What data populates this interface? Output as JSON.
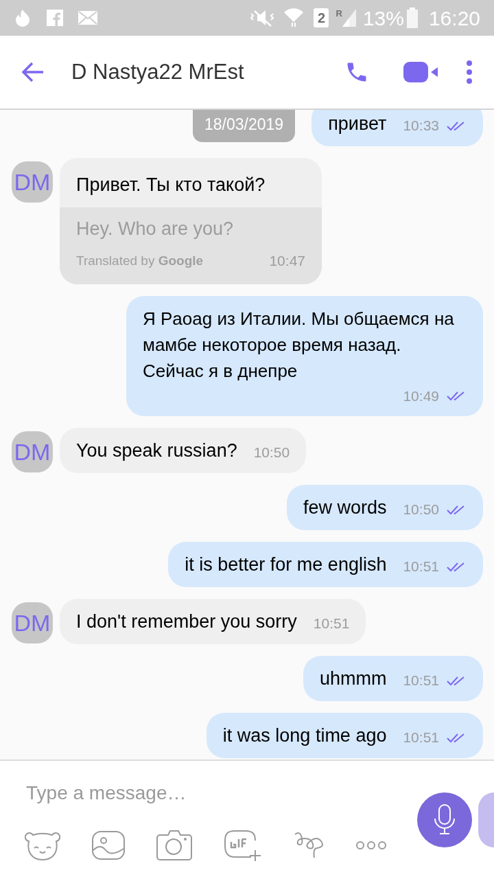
{
  "status_bar": {
    "sim_slot": "2",
    "roaming": "R",
    "battery": "13%",
    "time": "16:20"
  },
  "header": {
    "title": "D Nastya22 MrEst"
  },
  "date_chip": "18/03/2019",
  "messages": [
    {
      "kind": "outgoing",
      "text": "привет",
      "time": "10:33",
      "read": true
    },
    {
      "kind": "translated",
      "avatar": "DM",
      "text": "Привет. Ты кто такой?",
      "translation": "Hey. Who are you?",
      "credit": "Translated by **Google**",
      "time": "10:47"
    },
    {
      "kind": "outgoing",
      "text": "Я Paoag из Италии. Мы общаемся на мамбе некоторое время назад. Сейчас я в днепре",
      "time": "10:49",
      "read": true
    },
    {
      "kind": "incoming",
      "avatar": "DM",
      "text": "You speak russian?",
      "time": "10:50"
    },
    {
      "kind": "outgoing",
      "text": "few words",
      "time": "10:50",
      "read": true
    },
    {
      "kind": "outgoing",
      "text": "it is better for me english",
      "time": "10:51",
      "read": true
    },
    {
      "kind": "incoming",
      "avatar": "DM",
      "text": "I don't remember you sorry",
      "time": "10:51"
    },
    {
      "kind": "outgoing",
      "text": "uhmmm",
      "time": "10:51",
      "read": true
    },
    {
      "kind": "outgoing",
      "text": "it was long time ago",
      "time": "10:51",
      "read": true
    }
  ],
  "composer": {
    "placeholder": "Type a message…"
  }
}
